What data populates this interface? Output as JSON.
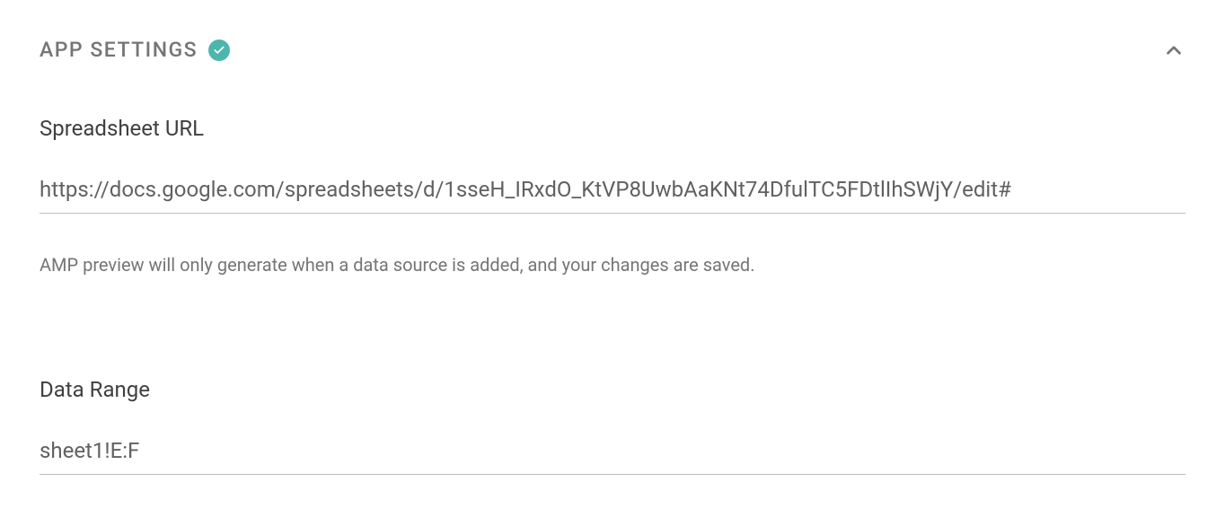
{
  "section": {
    "title": "APP SETTINGS"
  },
  "fields": {
    "spreadsheet_url": {
      "label": "Spreadsheet URL",
      "value": "https://docs.google.com/spreadsheets/d/1sseH_IRxdO_KtVP8UwbAaKNt74DfulTC5FDtlIhSWjY/edit#",
      "helper": "AMP preview will only generate when a data source is added, and your changes are saved."
    },
    "data_range": {
      "label": "Data Range",
      "value": "sheet1!E:F"
    }
  }
}
